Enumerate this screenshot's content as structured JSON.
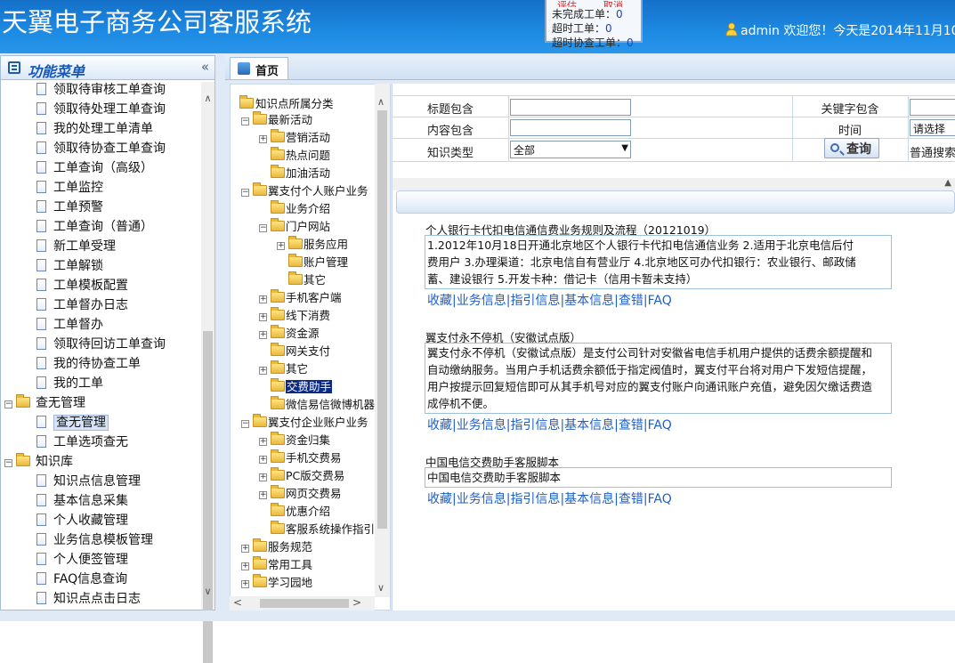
{
  "header": {
    "app_title": "天翼电子商务公司客服系统",
    "notice": {
      "top_left": "评估",
      "top_right": "取消",
      "rows": [
        {
          "label": "未完成工单：",
          "value": "0"
        },
        {
          "label": "超时工单：",
          "value": "0"
        },
        {
          "label": "超时协查工单：",
          "value": "0"
        }
      ]
    },
    "user_text": "admin 欢迎您！今天是2014年11月10"
  },
  "left_menu": {
    "title": "功能菜单",
    "collapse_glyph": "«",
    "items": [
      "领取待审核工单查询",
      "领取待处理工单查询",
      "我的处理工单清单",
      "领取待协查工单查询",
      "工单查询（高级）",
      "工单监控",
      "工单预警",
      "工单查询（普通）",
      "新工单受理",
      "工单解锁",
      "工单模板配置",
      "工单督办日志",
      "工单督办",
      "领取待回访工单查询",
      "我的待协查工单",
      "我的工单"
    ],
    "group1": {
      "label": "查无管理",
      "items": [
        "查无管理",
        "工单选项查无"
      ]
    },
    "group2": {
      "label": "知识库",
      "items": [
        "知识点信息管理",
        "基本信息采集",
        "个人收藏管理",
        "业务信息模板管理",
        "个人便签管理",
        "FAQ信息查询",
        "知识点点击日志"
      ]
    }
  },
  "tabs": {
    "home": "首页"
  },
  "tree": {
    "root": "知识点所属分类",
    "nodes": [
      {
        "label": "最新活动",
        "level": 1,
        "exp": "-"
      },
      {
        "label": "营销活动",
        "level": 2,
        "exp": "+"
      },
      {
        "label": "热点问题",
        "level": 2,
        "exp": ""
      },
      {
        "label": "加油活动",
        "level": 2,
        "exp": ""
      },
      {
        "label": "翼支付个人账户业务",
        "level": 1,
        "exp": "-"
      },
      {
        "label": "业务介绍",
        "level": 2,
        "exp": ""
      },
      {
        "label": "门户网站",
        "level": 2,
        "exp": "-"
      },
      {
        "label": "服务应用",
        "level": 3,
        "exp": "+"
      },
      {
        "label": "账户管理",
        "level": 3,
        "exp": ""
      },
      {
        "label": "其它",
        "level": 3,
        "exp": ""
      },
      {
        "label": "手机客户端",
        "level": 2,
        "exp": "+"
      },
      {
        "label": "线下消费",
        "level": 2,
        "exp": "+"
      },
      {
        "label": "资金源",
        "level": 2,
        "exp": "+"
      },
      {
        "label": "网关支付",
        "level": 2,
        "exp": ""
      },
      {
        "label": "其它",
        "level": 2,
        "exp": "+"
      },
      {
        "label": "交费助手",
        "level": 2,
        "exp": ""
      },
      {
        "label": "微信易信微博机器人",
        "level": 2,
        "exp": ""
      },
      {
        "label": "翼支付企业账户业务",
        "level": 1,
        "exp": "-"
      },
      {
        "label": "资金归集",
        "level": 2,
        "exp": "+"
      },
      {
        "label": "手机交费易",
        "level": 2,
        "exp": "+"
      },
      {
        "label": "PC版交费易",
        "level": 2,
        "exp": "+"
      },
      {
        "label": "网页交费易",
        "level": 2,
        "exp": "+"
      },
      {
        "label": "优惠介绍",
        "level": 2,
        "exp": ""
      },
      {
        "label": "客服系统操作指引",
        "level": 2,
        "exp": ""
      },
      {
        "label": "服务规范",
        "level": 1,
        "exp": "+"
      },
      {
        "label": "常用工具",
        "level": 1,
        "exp": "+"
      },
      {
        "label": "学习园地",
        "level": 1,
        "exp": "+"
      }
    ]
  },
  "search_form": {
    "title_label": "标题包含",
    "keyword_label": "关键字包含",
    "content_label": "内容包含",
    "time_label": "时间",
    "time_value": "请选择",
    "type_label": "知识类型",
    "type_value": "全部",
    "search_button": "查询",
    "mode_text": "普通搜索"
  },
  "results": [
    {
      "title": "个人银行卡代扣电信通信费业务规则及流程（20121019）",
      "lines": [
        "1.2012年10月18日开通北京地区个人银行卡代扣电信通信业务 2.适用于北京电信后付",
        "费用户 3.办理渠道：北京电信自有营业厅 4.北京地区可办代扣银行：农业银行、邮政储",
        "蓄、建设银行 5.开发卡种：借记卡（信用卡暂未支持）"
      ]
    },
    {
      "title": "翼支付永不停机（安徽试点版）",
      "lines": [
        "翼支付永不停机（安徽试点版）是支付公司针对安徽省电信手机用户提供的话费余额提醒和",
        "自动缴纳服务。当用户手机话费余额低于指定阀值时，翼支付平台将对用户下发短信提醒，",
        "用户按提示回复短信即可从其手机号对应的翼支付账户向通讯账户充值，避免因欠缴话费造",
        "成停机不便。"
      ]
    },
    {
      "title": "中国电信交费助手客服脚本",
      "lines": [
        "中国电信交费助手客服脚本"
      ]
    }
  ],
  "result_links": [
    "收藏",
    "业务信息",
    "指引信息",
    "基本信息",
    "查错",
    "FAQ"
  ],
  "colors": {
    "header": "#1d8ae3",
    "link": "#1d5fc9",
    "panel_bg": "#dfeaf6"
  }
}
